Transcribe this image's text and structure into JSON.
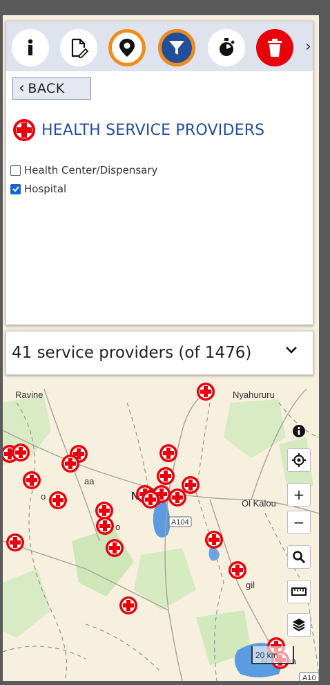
{
  "toolbar": {
    "buttons": [
      {
        "name": "info-icon"
      },
      {
        "name": "edit-document-icon"
      },
      {
        "name": "location-pin-icon"
      },
      {
        "name": "filter-icon"
      },
      {
        "name": "stopwatch-icon"
      },
      {
        "name": "trash-icon"
      }
    ],
    "more": "›"
  },
  "back": {
    "label": "BACK",
    "chevron": "‹"
  },
  "section": {
    "title": "HEALTH SERVICE PROVIDERS",
    "icon": "red-cross-icon"
  },
  "filters": [
    {
      "label": "Health Center/Dispensary",
      "checked": false
    },
    {
      "label": "Hospital",
      "checked": true
    }
  ],
  "results": {
    "summary": "41 service providers (of 1476)"
  },
  "map": {
    "places": [
      "Ravine",
      "Nyahururu",
      "Nakuru",
      "Ol Kalou",
      "A104",
      "20 km",
      "A10",
      "gil",
      "aa",
      "o",
      "o",
      "N",
      "sha"
    ],
    "controls": [
      "i",
      "+",
      "−"
    ],
    "colors": {
      "marker": "#e8000b",
      "water": "#5b9be0",
      "land": "#f7f0df",
      "park": "#cde6b8"
    }
  }
}
